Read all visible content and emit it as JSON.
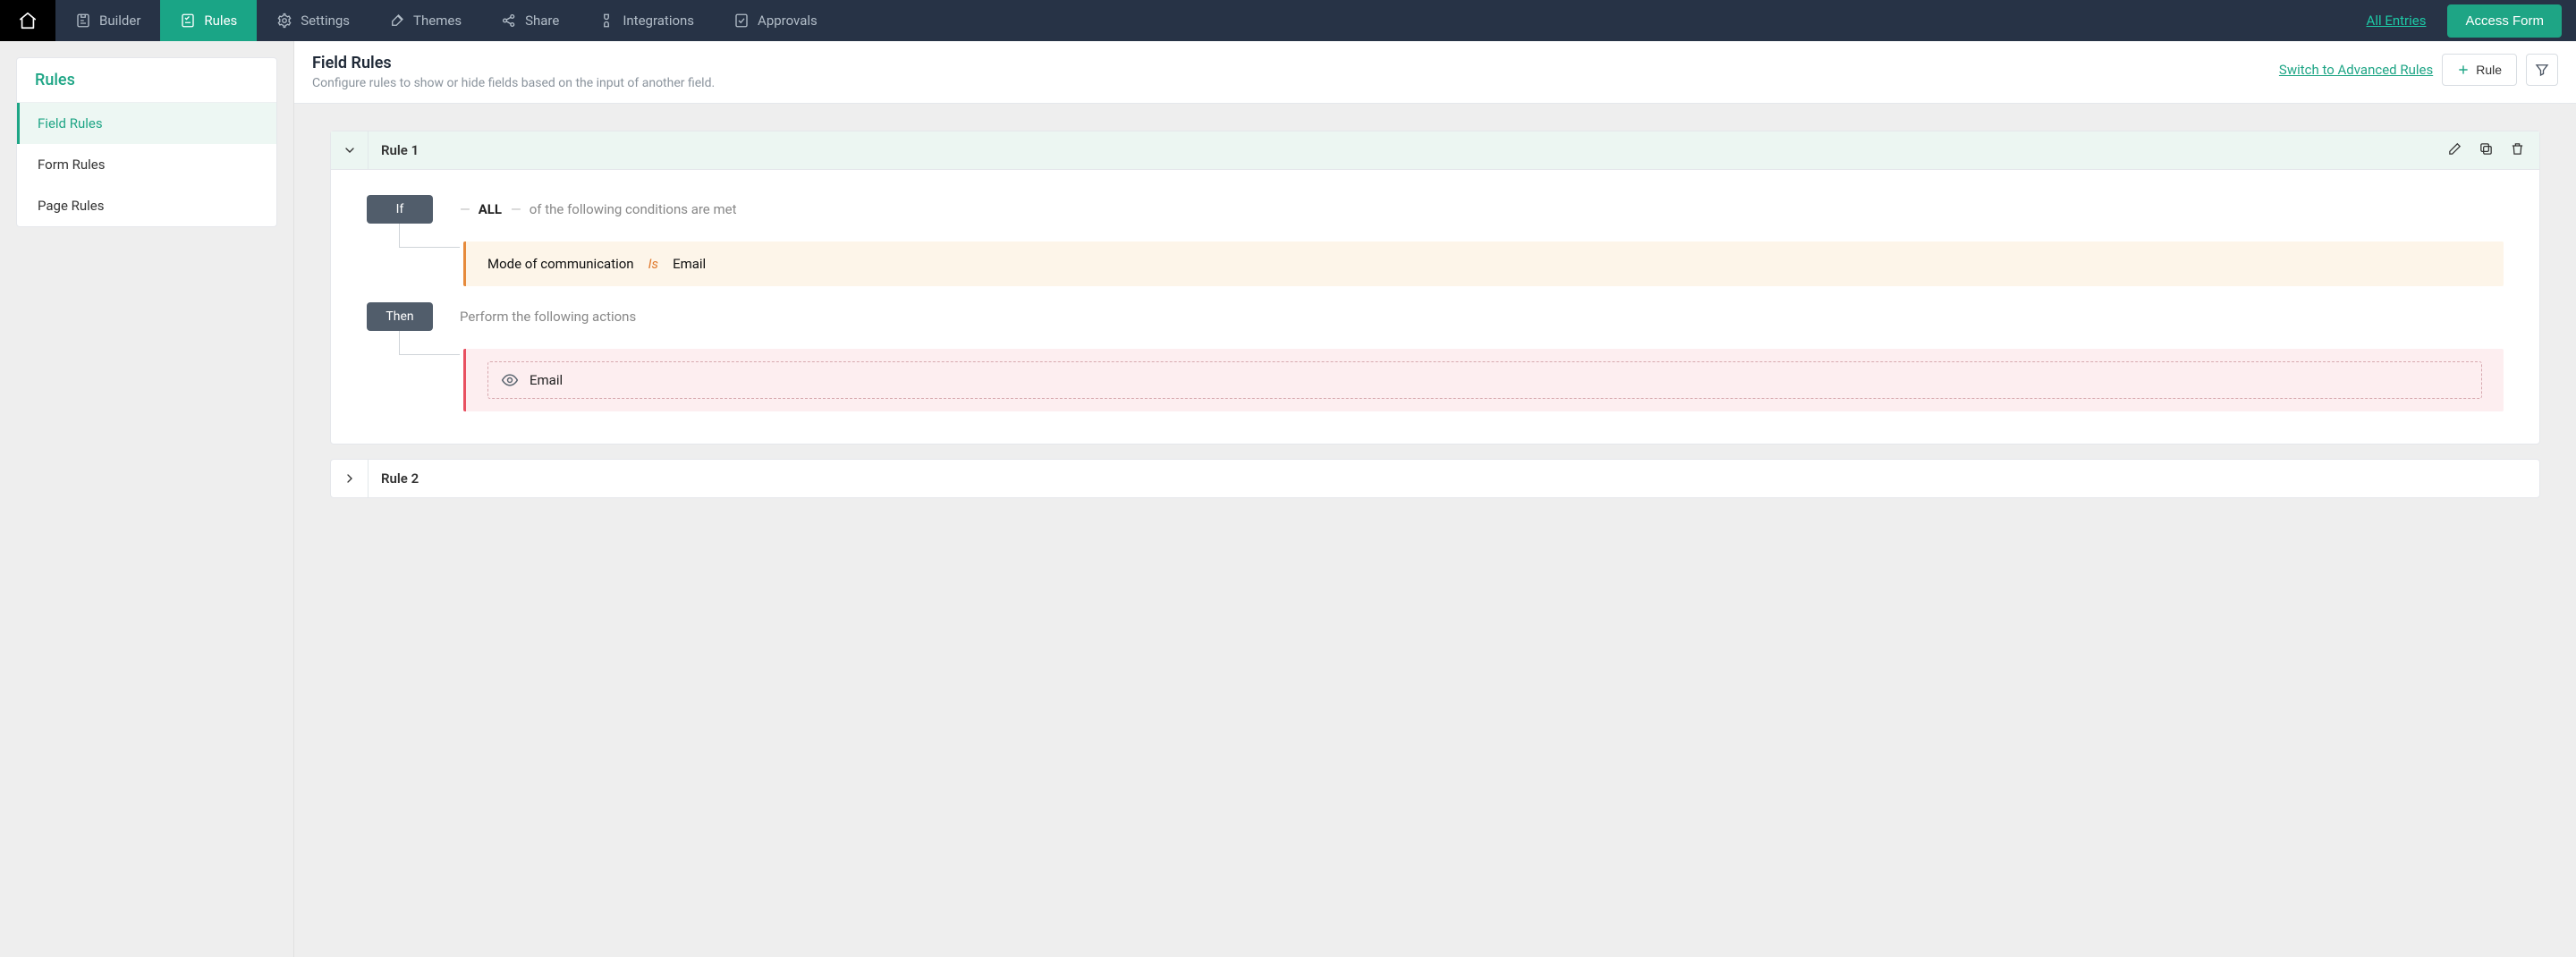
{
  "nav": {
    "items": [
      {
        "key": "builder",
        "label": "Builder"
      },
      {
        "key": "rules",
        "label": "Rules"
      },
      {
        "key": "settings",
        "label": "Settings"
      },
      {
        "key": "themes",
        "label": "Themes"
      },
      {
        "key": "share",
        "label": "Share"
      },
      {
        "key": "integrations",
        "label": "Integrations"
      },
      {
        "key": "approvals",
        "label": "Approvals"
      }
    ],
    "active": "rules",
    "all_entries_label": "All Entries",
    "access_form_label": "Access Form"
  },
  "sidebar": {
    "title": "Rules",
    "items": [
      {
        "label": "Field Rules",
        "selected": true
      },
      {
        "label": "Form Rules",
        "selected": false
      },
      {
        "label": "Page Rules",
        "selected": false
      }
    ]
  },
  "header": {
    "title": "Field Rules",
    "subtitle": "Configure rules to show or hide fields based on the input of another field.",
    "switch_label": "Switch to Advanced Rules",
    "add_rule_label": "Rule"
  },
  "rules": [
    {
      "title": "Rule 1",
      "expanded": true,
      "if": {
        "badge": "If",
        "quantifier": "ALL",
        "suffix": "of the following conditions are met",
        "conditions": [
          {
            "field": "Mode of communication",
            "op": "Is",
            "value": "Email"
          }
        ]
      },
      "then": {
        "badge": "Then",
        "heading": "Perform the following actions",
        "actions": [
          {
            "icon": "eye",
            "label": "Email"
          }
        ]
      }
    },
    {
      "title": "Rule 2",
      "expanded": false
    }
  ]
}
